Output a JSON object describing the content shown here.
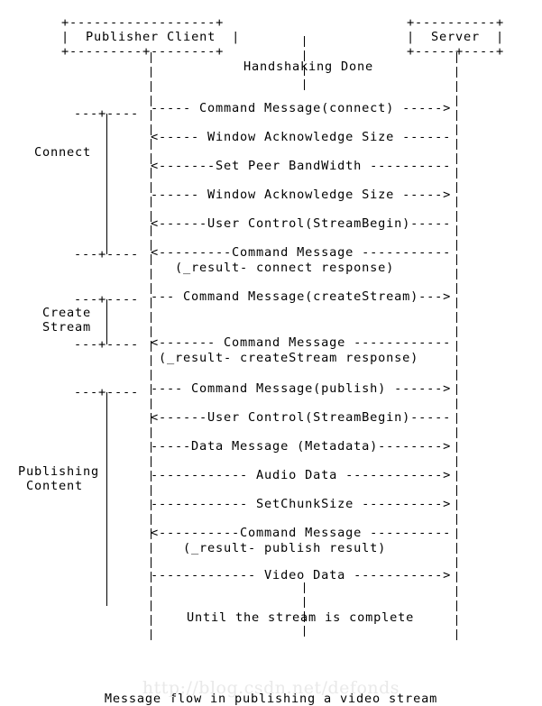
{
  "figure": {
    "caption": "Message flow in publishing a video stream",
    "watermark": "http://blog.csdn.net/defonds",
    "background_color": "#ffffff",
    "text_color": "#000000",
    "watermark_color": "#e9e9e9"
  },
  "participants": {
    "client": {
      "label": "Publisher Client",
      "box_top": "+------------------+",
      "box_mid": "|  Publisher Client  |",
      "box_bot": "+---------+--------+"
    },
    "server": {
      "label": "Server",
      "box_top": "+----------+",
      "box_mid": "|  Server  |",
      "box_bot": "+-----+----+"
    }
  },
  "phases": [
    {
      "name": "connect",
      "label_lines": [
        "Connect"
      ]
    },
    {
      "name": "create-stream",
      "label_lines": [
        "Create",
        "Stream"
      ]
    },
    {
      "name": "publishing-content",
      "label_lines": [
        "Publishing",
        "Content"
      ]
    }
  ],
  "notes": {
    "handshaking": "Handshaking Done",
    "until_complete": "Until the stream is complete"
  },
  "messages": [
    {
      "id": "connect",
      "dir": "to-server",
      "text": "----- Command Message(connect) ----->"
    },
    {
      "id": "window-ack-1",
      "dir": "to-client",
      "text": "<----- Window Acknowledge Size ------"
    },
    {
      "id": "set-peer-bandwidth",
      "dir": "to-client",
      "text": "<-------Set Peer BandWidth ----------"
    },
    {
      "id": "window-ack-2",
      "dir": "to-server",
      "text": "------ Window Acknowledge Size ----->"
    },
    {
      "id": "user-control-1",
      "dir": "to-client",
      "text": "<------User Control(StreamBegin)-----"
    },
    {
      "id": "connect-result",
      "dir": "to-client",
      "text": "<---------Command Message -----------",
      "sub": "(_result- connect response)"
    },
    {
      "id": "create-stream",
      "dir": "to-server",
      "text": "--- Command Message(createStream)--->"
    },
    {
      "id": "create-stream-result",
      "dir": "to-client",
      "text": "<------- Command Message ------------",
      "sub": "(_result- createStream response)"
    },
    {
      "id": "publish",
      "dir": "to-server",
      "text": "---- Command Message(publish) ------>"
    },
    {
      "id": "user-control-2",
      "dir": "to-client",
      "text": "<------User Control(StreamBegin)-----"
    },
    {
      "id": "data-metadata",
      "dir": "to-server",
      "text": "-----Data Message (Metadata)-------->"
    },
    {
      "id": "audio-data",
      "dir": "to-server",
      "text": "------------ Audio Data ------------>"
    },
    {
      "id": "set-chunk-size",
      "dir": "to-server",
      "text": "------------ SetChunkSize ---------->"
    },
    {
      "id": "publish-result",
      "dir": "to-client",
      "text": "<----------Command Message ----------",
      "sub": "(_result- publish result)"
    },
    {
      "id": "video-data",
      "dir": "to-server",
      "text": "------------- Video Data ----------->"
    }
  ],
  "brackets": [
    {
      "id": "connect-open",
      "marker": "---+----"
    },
    {
      "id": "connect-close",
      "marker": "---+----"
    },
    {
      "id": "create-stream-open",
      "marker": "---+----"
    },
    {
      "id": "create-stream-close",
      "marker": "---+----"
    },
    {
      "id": "publishing-content-open",
      "marker": "---+----"
    }
  ]
}
